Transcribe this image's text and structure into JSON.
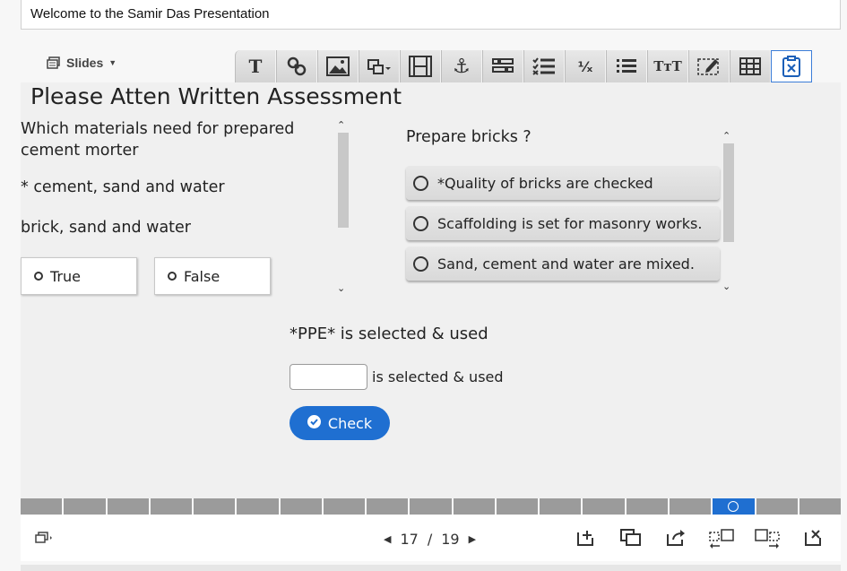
{
  "presentation_title": "Welcome to the Samir Das Presentation",
  "slides_menu": {
    "label": "Slides",
    "icon": "slides-icon",
    "arrow_icon": "caret-down-icon"
  },
  "toolbar": {
    "tools": [
      {
        "name": "text-tool",
        "glyph": "T"
      },
      {
        "name": "link-tool",
        "glyph": ""
      },
      {
        "name": "image-tool",
        "glyph": ""
      },
      {
        "name": "shape-tool",
        "glyph": ""
      },
      {
        "name": "video-tool",
        "glyph": ""
      },
      {
        "name": "anchor-tool",
        "glyph": "⚓"
      },
      {
        "name": "form-tool",
        "glyph": ""
      },
      {
        "name": "checklist-tool",
        "glyph": ""
      },
      {
        "name": "math-tool",
        "glyph": "⅟ₓ"
      },
      {
        "name": "list-tool",
        "glyph": ""
      },
      {
        "name": "text-size-tool",
        "glyph": "TᴛT"
      },
      {
        "name": "edit-tool",
        "glyph": ""
      },
      {
        "name": "table-tool",
        "glyph": ""
      },
      {
        "name": "assessment-tool",
        "glyph": "",
        "active": true
      }
    ]
  },
  "slide": {
    "title": "Please Atten Written Assessment",
    "question1": {
      "text": "Which materials need for prepared cement morter",
      "option1": "* cement, sand and water",
      "option2": "brick, sand and water",
      "true_label": "True",
      "false_label": "False"
    },
    "question2": {
      "text": "Prepare bricks ?",
      "options": [
        "*Quality of bricks are checked",
        "Scaffolding is set for masonry works.",
        "Sand, cement and water are mixed."
      ]
    },
    "fill_blank": {
      "answer_line": "*PPE* is selected & used",
      "after_text": "is selected & used",
      "input_value": ""
    },
    "check_label": "Check"
  },
  "progress": {
    "total": 19,
    "current": 17
  },
  "pager": {
    "current": "17",
    "separator": "/",
    "total": "19"
  },
  "colors": {
    "accent": "#1f6fd1",
    "progress_gray": "#9b9b9b"
  }
}
